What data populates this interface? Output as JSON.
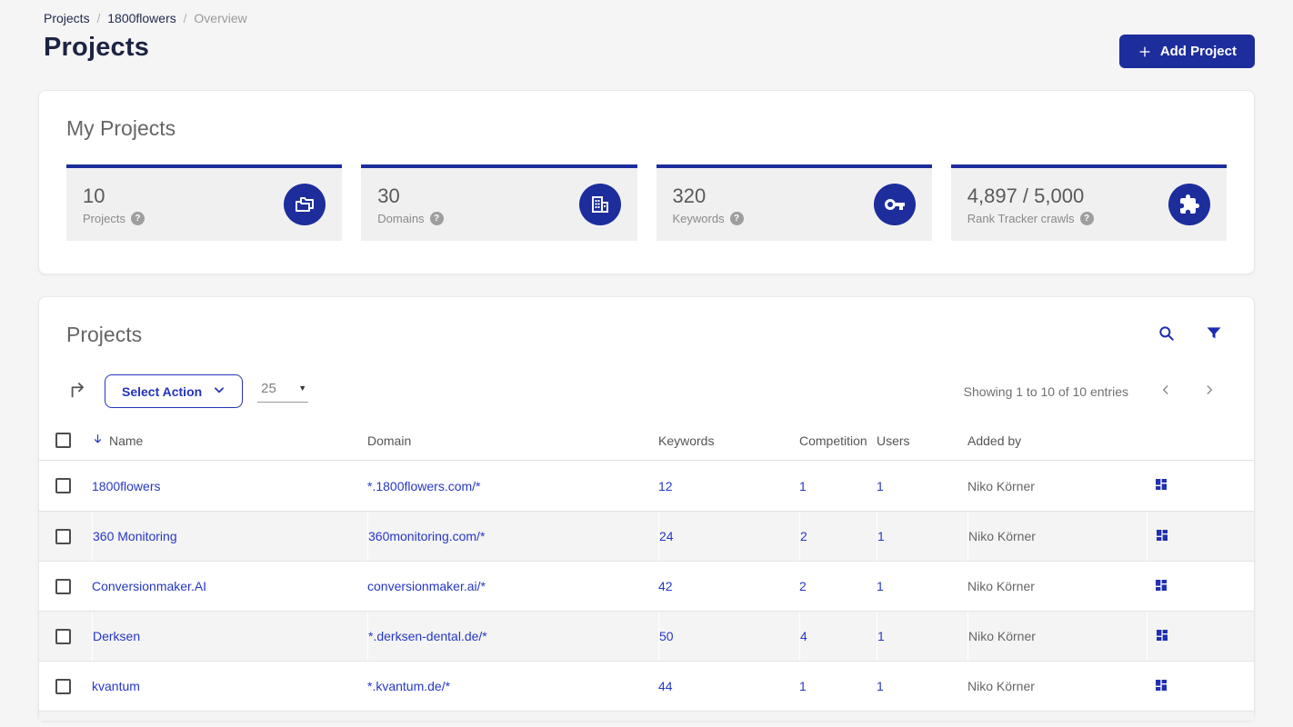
{
  "colors": {
    "brand_blue": "#1d2d9c",
    "link_blue": "#2737c4"
  },
  "header": {
    "breadcrumb": {
      "items": [
        "Projects",
        "1800flowers",
        "Overview"
      ],
      "separator": "/"
    },
    "title": "Projects",
    "add_project_label": "Add Project"
  },
  "stats_panel": {
    "title": "My Projects",
    "cards": [
      {
        "value": "10",
        "label": "Projects",
        "icon": "folders-icon",
        "help_icon": "?"
      },
      {
        "value": "30",
        "label": "Domains",
        "icon": "building-icon",
        "help_icon": "?"
      },
      {
        "value": "320",
        "label": "Keywords",
        "icon": "key-icon",
        "help_icon": "?"
      },
      {
        "value": "4,897 / 5,000",
        "label": "Rank Tracker crawls",
        "icon": "puzzle-icon",
        "help_icon": "?"
      }
    ]
  },
  "projects_panel": {
    "title": "Projects",
    "toolbar": {
      "select_action_label": "Select Action",
      "page_size_value": "25",
      "showing_text": "Showing 1 to 10 of 10 entries"
    },
    "table": {
      "columns": [
        "Name",
        "Domain",
        "Keywords",
        "Competition",
        "Users",
        "Added by"
      ],
      "sorted_column": "Name",
      "sort_direction": "descending",
      "rows": [
        {
          "name": "1800flowers",
          "domain": "*.1800flowers.com/*",
          "keywords": "12",
          "competition": "1",
          "users": "1",
          "added_by": "Niko Körner"
        },
        {
          "name": "360 Monitoring",
          "domain": "360monitoring.com/*",
          "keywords": "24",
          "competition": "2",
          "users": "1",
          "added_by": "Niko Körner"
        },
        {
          "name": "Conversionmaker.AI",
          "domain": "conversionmaker.ai/*",
          "keywords": "42",
          "competition": "2",
          "users": "1",
          "added_by": "Niko Körner"
        },
        {
          "name": "Derksen",
          "domain": "*.derksen-dental.de/*",
          "keywords": "50",
          "competition": "4",
          "users": "1",
          "added_by": "Niko Körner"
        },
        {
          "name": "kvantum",
          "domain": "*.kvantum.de/*",
          "keywords": "44",
          "competition": "1",
          "users": "1",
          "added_by": "Niko Körner"
        }
      ]
    }
  }
}
